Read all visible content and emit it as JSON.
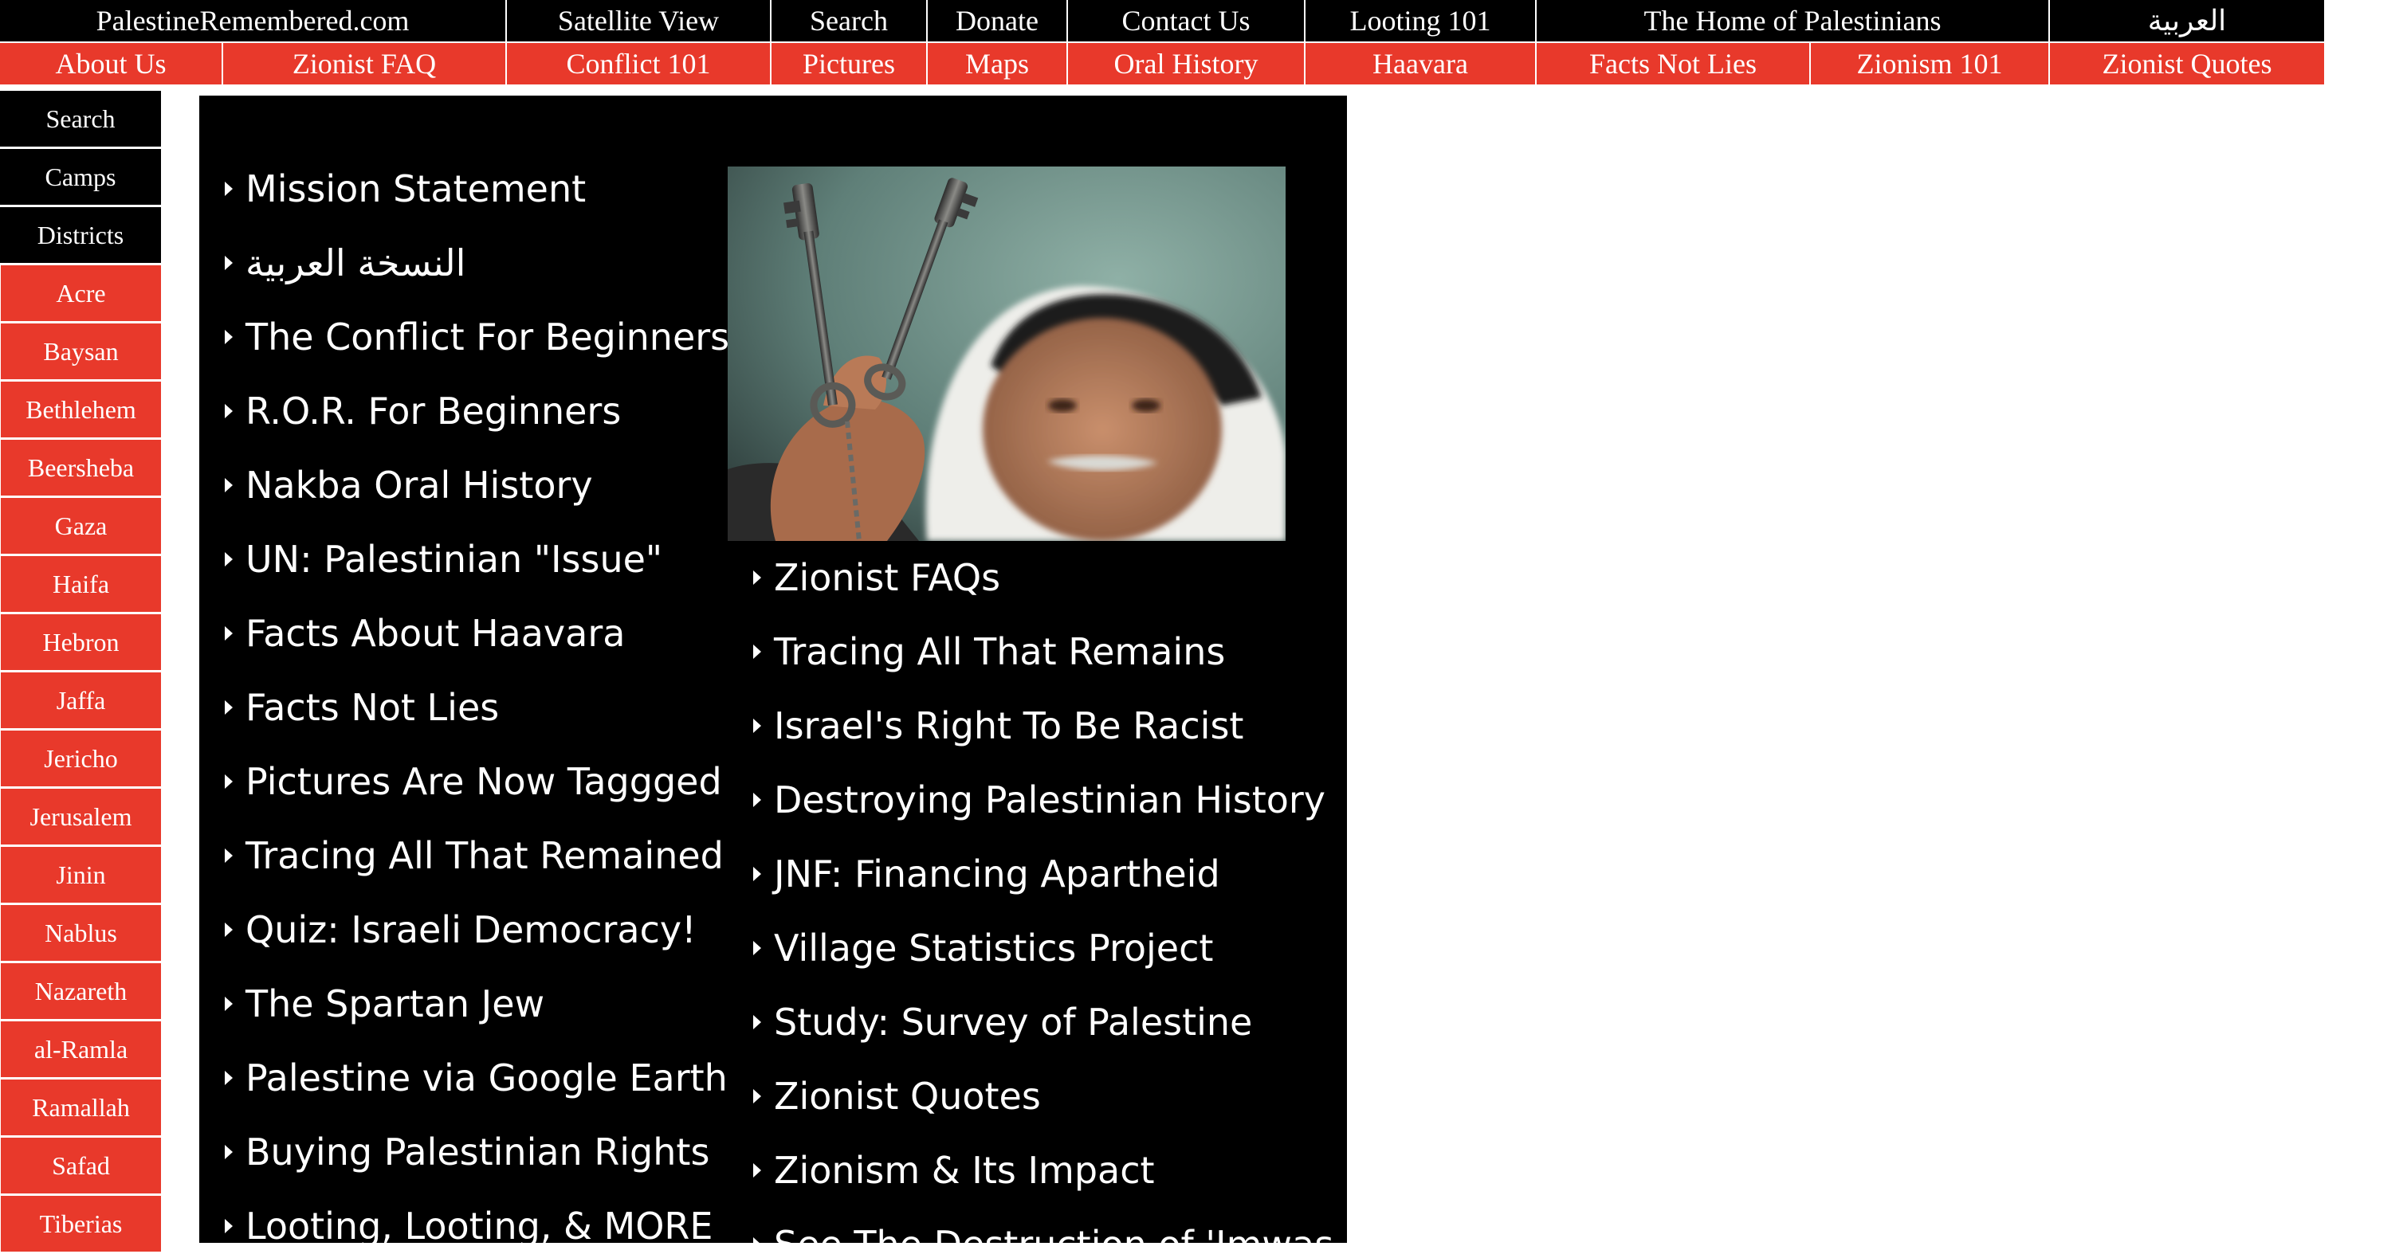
{
  "nav_top": [
    {
      "label": "PalestineRemembered.com",
      "name": "nav-home-link"
    },
    {
      "label": "Satellite View",
      "name": "nav-satellite-view"
    },
    {
      "label": "Search",
      "name": "nav-search"
    },
    {
      "label": "Donate",
      "name": "nav-donate"
    },
    {
      "label": "Contact Us",
      "name": "nav-contact-us"
    },
    {
      "label": "Looting 101",
      "name": "nav-looting-101"
    },
    {
      "label": "The Home of Palestinians",
      "name": "nav-home-of-palestinians"
    },
    {
      "label": "العربية",
      "name": "nav-arabic"
    }
  ],
  "nav_second": [
    {
      "label": "About Us",
      "name": "nav-about-us"
    },
    {
      "label": "Zionist FAQ",
      "name": "nav-zionist-faq"
    },
    {
      "label": "Conflict 101",
      "name": "nav-conflict-101"
    },
    {
      "label": "Pictures",
      "name": "nav-pictures"
    },
    {
      "label": "Maps",
      "name": "nav-maps"
    },
    {
      "label": "Oral History",
      "name": "nav-oral-history"
    },
    {
      "label": "Haavara",
      "name": "nav-haavara"
    },
    {
      "label": "Facts Not Lies",
      "name": "nav-facts-not-lies"
    },
    {
      "label": "Zionism 101",
      "name": "nav-zionism-101"
    },
    {
      "label": "Zionist Quotes",
      "name": "nav-zionist-quotes"
    }
  ],
  "sidebar": {
    "black_items": [
      "Search",
      "Camps",
      "Districts"
    ],
    "districts": [
      "Acre",
      "Baysan",
      "Bethlehem",
      "Beersheba",
      "Gaza",
      "Haifa",
      "Hebron",
      "Jaffa",
      "Jericho",
      "Jerusalem",
      "Jinin",
      "Nablus",
      "Nazareth",
      "al-Ramla",
      "Ramallah",
      "Safad",
      "Tiberias"
    ]
  },
  "main": {
    "image_subject": "elderly man in keffiyeh holding two old keys",
    "left_links": [
      "Mission Statement",
      "النسخة العربية",
      "The Conflict For Beginners",
      "R.O.R. For Beginners",
      "Nakba Oral History",
      "UN: Palestinian \"Issue\"",
      "Facts About Haavara",
      "Facts Not Lies",
      "Pictures Are Now Taggged",
      "Tracing All That Remained",
      "Quiz: Israeli Democracy!",
      "The Spartan Jew",
      "Palestine via Google Earth",
      "Buying Palestinian Rights",
      "Looting, Looting, & MORE"
    ],
    "right_links": [
      "Zionist FAQs",
      "Tracing All That Remains",
      "Israel's Right To Be Racist",
      "Destroying Palestinian History",
      "JNF: Financing Apartheid",
      "Village Statistics Project",
      "Study: Survey of Palestine",
      "Zionist Quotes",
      "Zionism & Its Impact",
      "See The Destruction of 'Imwas"
    ]
  },
  "colors": {
    "nav_black": "#000000",
    "nav_red": "#e8392b",
    "panel": "#000000",
    "text": "#ffffff"
  }
}
